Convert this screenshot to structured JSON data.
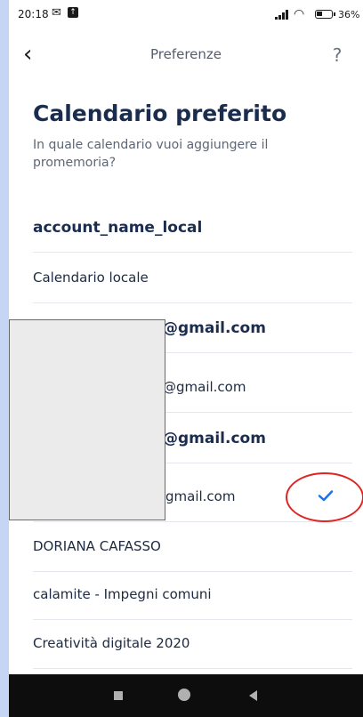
{
  "status_bar": {
    "time": "20:18",
    "battery": "36%",
    "icons": [
      "mail-icon",
      "upload-icon",
      "signal-icon",
      "wifi-icon",
      "battery-icon"
    ]
  },
  "nav": {
    "back_glyph": "‹",
    "title": "Preferenze",
    "help_glyph": "?"
  },
  "page": {
    "title": "Calendario preferito",
    "subtitle": "In quale calendario vuoi aggiungere il promemoria?"
  },
  "calendars": [
    {
      "label": "account_name_local",
      "kind": "header"
    },
    {
      "label": "Calendario locale",
      "kind": "item"
    },
    {
      "label": "@gmail.com",
      "kind": "header"
    },
    {
      "label": "@gmail.com",
      "kind": "item"
    },
    {
      "label": "@gmail.com",
      "kind": "header"
    },
    {
      "label": "gmail.com",
      "kind": "item",
      "selected": true
    },
    {
      "label": "DORIANA CAFASSO",
      "kind": "item"
    },
    {
      "label": "calamite - Impegni comuni",
      "kind": "item"
    },
    {
      "label": "Creatività digitale 2020",
      "kind": "item"
    }
  ],
  "colors": {
    "accent": "#1a73e8",
    "title": "#1b2d4f",
    "annotation": "#e02424",
    "frame": "#c5d6f5"
  }
}
